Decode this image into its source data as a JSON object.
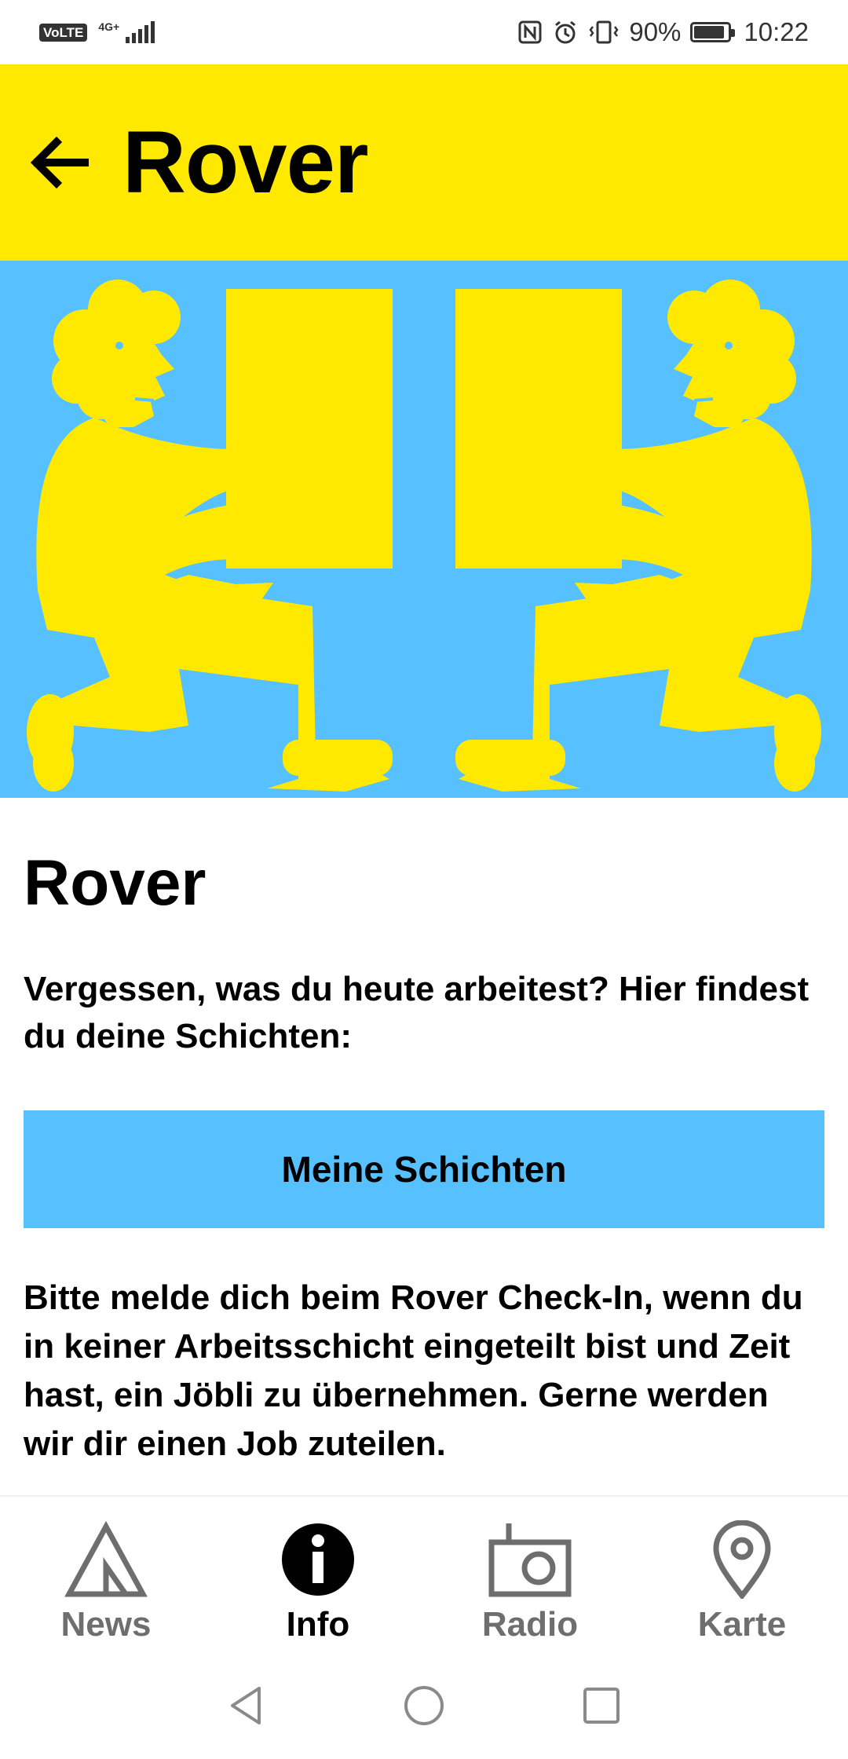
{
  "status_bar": {
    "volte": "VoLTE",
    "network": "4G+",
    "battery": "90%",
    "time": "10:22"
  },
  "header": {
    "title": "Rover",
    "back_icon": "arrow-left-icon"
  },
  "hero": {
    "image": "two-figures-carrying-boxes-illustration",
    "background_color": "#56C1FE",
    "figure_color": "#FFE900"
  },
  "content": {
    "title": "Rover",
    "intro": "Vergessen, was du heute arbeitest? Hier findest du deine Schichten:",
    "button_label": "Meine Schichten",
    "checkin_text": "Bitte melde dich beim Rover Check-In, wenn du in keiner Arbeitsschicht eingeteilt bist und Zeit hast, ein Jöbli zu übernehmen. Gerne werden wir dir einen Job zuteilen."
  },
  "bottom_nav": {
    "items": [
      {
        "label": "News",
        "icon": "tent-icon",
        "active": false
      },
      {
        "label": "Info",
        "icon": "info-icon",
        "active": true
      },
      {
        "label": "Radio",
        "icon": "radio-icon",
        "active": false
      },
      {
        "label": "Karte",
        "icon": "map-pin-icon",
        "active": false
      }
    ]
  },
  "system_nav": {
    "back": "nav-back-icon",
    "home": "nav-home-icon",
    "recents": "nav-recents-icon"
  },
  "colors": {
    "accent_yellow": "#FFE900",
    "accent_blue": "#56C1FE",
    "inactive_nav": "#6E6E6E"
  }
}
